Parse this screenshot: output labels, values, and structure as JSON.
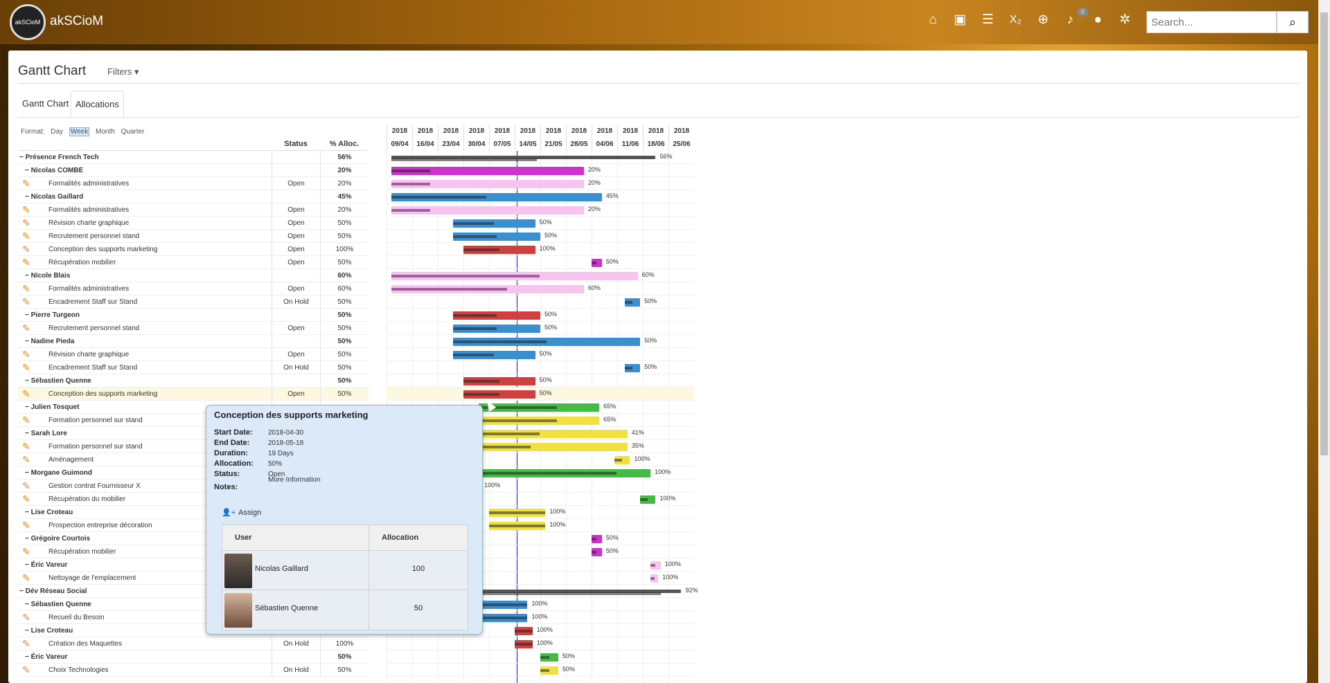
{
  "app": {
    "brand": "akSCioM",
    "logo_text": "akSCioM"
  },
  "nav": {
    "icons": [
      "home-icon",
      "briefcase-icon",
      "tasks-icon",
      "subscript-icon",
      "plus-circle-icon",
      "bell-icon",
      "user-icon",
      "gear-icon"
    ],
    "notification_count": "0",
    "search_placeholder": "Search..."
  },
  "page": {
    "title": "Gantt Chart",
    "filters_label": "Filters ▾",
    "tabs": [
      "Gantt Chart",
      "Allocations"
    ],
    "active_tab": "Allocations"
  },
  "format": {
    "label": "Format:",
    "options": [
      "Day",
      "Week",
      "Month",
      "Quarter"
    ],
    "selected": "Week"
  },
  "columns": {
    "status": "Status",
    "alloc": "% Alloc."
  },
  "timeline": {
    "years": [
      "2018",
      "2018",
      "2018",
      "2018",
      "2018",
      "2018",
      "2018",
      "2018",
      "2018",
      "2018",
      "2018",
      "2018"
    ],
    "weeks": [
      "09/04",
      "16/04",
      "23/04",
      "30/04",
      "07/05",
      "14/05",
      "21/05",
      "28/05",
      "04/06",
      "11/06",
      "18/06",
      "25/06"
    ]
  },
  "rows": [
    {
      "level": 0,
      "name": "Présence French Tech",
      "status": "",
      "alloc": "56%",
      "bar": {
        "s": 0.2,
        "e": 10.5,
        "color": "#555",
        "prog": 0.55,
        "summary": true,
        "label": "56%"
      }
    },
    {
      "level": 1,
      "name": "Nicolas COMBE",
      "status": "",
      "alloc": "20%",
      "bar": {
        "s": 0.2,
        "e": 7.7,
        "color": "#cc33cc",
        "prog": 0.2,
        "label": "20%"
      }
    },
    {
      "level": 2,
      "name": "Formalités administratives",
      "status": "Open",
      "alloc": "20%",
      "bar": {
        "s": 0.2,
        "e": 7.7,
        "color": "#f6c4ef",
        "prog": 0.2,
        "label": "20%",
        "dark": "#a060a0"
      }
    },
    {
      "level": 1,
      "name": "Nicolas Gaillard",
      "status": "",
      "alloc": "45%",
      "bar": {
        "s": 0.2,
        "e": 8.4,
        "color": "#3a8fd0",
        "prog": 0.45,
        "label": "45%"
      }
    },
    {
      "level": 2,
      "name": "Formalités administratives",
      "status": "Open",
      "alloc": "20%",
      "bar": {
        "s": 0.2,
        "e": 7.7,
        "color": "#f6c4ef",
        "prog": 0.2,
        "label": "20%",
        "dark": "#a060a0"
      }
    },
    {
      "level": 2,
      "name": "Révision charte graphique",
      "status": "Open",
      "alloc": "50%",
      "bar": {
        "s": 2.6,
        "e": 5.8,
        "color": "#3a8fd0",
        "prog": 0.5,
        "label": "50%"
      }
    },
    {
      "level": 2,
      "name": "Recrutement personnel stand",
      "status": "Open",
      "alloc": "50%",
      "bar": {
        "s": 2.6,
        "e": 6.0,
        "color": "#3a8fd0",
        "prog": 0.5,
        "label": "50%"
      }
    },
    {
      "level": 2,
      "name": "Conception des supports marketing",
      "status": "Open",
      "alloc": "100%",
      "bar": {
        "s": 3.0,
        "e": 5.8,
        "color": "#d04040",
        "prog": 0.5,
        "label": "100%"
      }
    },
    {
      "level": 2,
      "name": "Récupération mobilier",
      "status": "Open",
      "alloc": "50%",
      "bar": {
        "s": 8.0,
        "e": 8.4,
        "color": "#cc33cc",
        "prog": 0.5,
        "label": "50%"
      }
    },
    {
      "level": 1,
      "name": "Nicole Blais",
      "status": "",
      "alloc": "60%",
      "bar": {
        "s": 0.2,
        "e": 9.8,
        "color": "#f6c4ef",
        "prog": 0.6,
        "label": "60%",
        "dark": "#a060a0"
      }
    },
    {
      "level": 2,
      "name": "Formalités administratives",
      "status": "Open",
      "alloc": "60%",
      "bar": {
        "s": 0.2,
        "e": 7.7,
        "color": "#f6c4ef",
        "prog": 0.6,
        "label": "60%",
        "dark": "#a060a0"
      }
    },
    {
      "level": 2,
      "name": "Encadrement Staff sur Stand",
      "status": "On Hold",
      "alloc": "50%",
      "bar": {
        "s": 9.3,
        "e": 9.9,
        "color": "#3a8fd0",
        "prog": 0.5,
        "label": "50%"
      }
    },
    {
      "level": 1,
      "name": "Pierre Turgeon",
      "status": "",
      "alloc": "50%",
      "bar": {
        "s": 2.6,
        "e": 6.0,
        "color": "#d04040",
        "prog": 0.5,
        "label": "50%"
      }
    },
    {
      "level": 2,
      "name": "Recrutement personnel stand",
      "status": "Open",
      "alloc": "50%",
      "bar": {
        "s": 2.6,
        "e": 6.0,
        "color": "#3a8fd0",
        "prog": 0.5,
        "label": "50%"
      }
    },
    {
      "level": 1,
      "name": "Nadine Pieda",
      "status": "",
      "alloc": "50%",
      "bar": {
        "s": 2.6,
        "e": 9.9,
        "color": "#3a8fd0",
        "prog": 0.5,
        "label": "50%"
      }
    },
    {
      "level": 2,
      "name": "Révision charte graphique",
      "status": "Open",
      "alloc": "50%",
      "bar": {
        "s": 2.6,
        "e": 5.8,
        "color": "#3a8fd0",
        "prog": 0.5,
        "label": "50%"
      }
    },
    {
      "level": 2,
      "name": "Encadrement Staff sur Stand",
      "status": "On Hold",
      "alloc": "50%",
      "bar": {
        "s": 9.3,
        "e": 9.9,
        "color": "#3a8fd0",
        "prog": 0.5,
        "label": "50%"
      }
    },
    {
      "level": 1,
      "name": "Sébastien Quenne",
      "status": "",
      "alloc": "50%",
      "bar": {
        "s": 3.0,
        "e": 5.8,
        "color": "#d04040",
        "prog": 0.5,
        "label": "50%"
      }
    },
    {
      "level": 2,
      "name": "Conception des supports marketing",
      "status": "Open",
      "alloc": "50%",
      "bar": {
        "s": 3.0,
        "e": 5.8,
        "color": "#d04040",
        "prog": 0.5,
        "label": "50%"
      },
      "hi": true
    },
    {
      "level": 1,
      "name": "Julien Tosquet",
      "status": "",
      "alloc": "",
      "bar": {
        "s": 3.6,
        "e": 8.3,
        "color": "#44bb44",
        "prog": 0.65,
        "label": "65%"
      }
    },
    {
      "level": 2,
      "name": "Formation personnel sur stand",
      "status": "",
      "alloc": "",
      "bar": {
        "s": 3.6,
        "e": 8.3,
        "color": "#f0e040",
        "prog": 0.65,
        "label": "65%"
      }
    },
    {
      "level": 1,
      "name": "Sarah Lore",
      "status": "",
      "alloc": "",
      "bar": {
        "s": 3.6,
        "e": 9.4,
        "color": "#f0e040",
        "prog": 0.41,
        "label": "41%"
      }
    },
    {
      "level": 2,
      "name": "Formation personnel sur stand",
      "status": "",
      "alloc": "",
      "bar": {
        "s": 3.6,
        "e": 9.4,
        "color": "#f0e040",
        "prog": 0.35,
        "label": "35%"
      }
    },
    {
      "level": 2,
      "name": "Aménagement",
      "status": "",
      "alloc": "",
      "bar": {
        "s": 8.9,
        "e": 9.5,
        "color": "#f0e040",
        "prog": 0.5,
        "label": "100%"
      }
    },
    {
      "level": 1,
      "name": "Morgane Guimond",
      "status": "",
      "alloc": "",
      "bar": {
        "s": 3.6,
        "e": 10.3,
        "color": "#44bb44",
        "prog": 0.8,
        "label": "100%"
      }
    },
    {
      "level": 2,
      "name": "Gestion contrat Fournisseur X",
      "status": "",
      "alloc": "",
      "bar": {
        "s": 3.6,
        "e": 3.6,
        "color": "#44bb44",
        "prog": 0,
        "label": "100%"
      }
    },
    {
      "level": 2,
      "name": "Récupération du mobilier",
      "status": "",
      "alloc": "",
      "bar": {
        "s": 9.9,
        "e": 10.5,
        "color": "#44bb44",
        "prog": 0.5,
        "label": "100%"
      }
    },
    {
      "level": 1,
      "name": "Lise Croteau",
      "status": "",
      "alloc": "",
      "bar": {
        "s": 4.0,
        "e": 6.2,
        "color": "#f0e040",
        "prog": 1,
        "label": "100%"
      }
    },
    {
      "level": 2,
      "name": "Prospection entreprise décoration",
      "status": "",
      "alloc": "",
      "bar": {
        "s": 4.0,
        "e": 6.2,
        "color": "#f0e040",
        "prog": 1,
        "label": "100%"
      }
    },
    {
      "level": 1,
      "name": "Grégoire Courtois",
      "status": "",
      "alloc": "",
      "bar": {
        "s": 8.0,
        "e": 8.4,
        "color": "#cc33cc",
        "prog": 0.5,
        "label": "50%"
      }
    },
    {
      "level": 2,
      "name": "Récupération mobilier",
      "status": "",
      "alloc": "",
      "bar": {
        "s": 8.0,
        "e": 8.4,
        "color": "#cc33cc",
        "prog": 0.5,
        "label": "50%"
      }
    },
    {
      "level": 1,
      "name": "Éric Vareur",
      "status": "",
      "alloc": "",
      "bar": {
        "s": 10.3,
        "e": 10.7,
        "color": "#f6c4ef",
        "prog": 0.5,
        "label": "100%",
        "dark": "#a060a0"
      }
    },
    {
      "level": 2,
      "name": "Nettoyage de l'emplacement",
      "status": "",
      "alloc": "",
      "bar": {
        "s": 10.3,
        "e": 10.6,
        "color": "#f6c4ef",
        "prog": 0.5,
        "label": "100%",
        "dark": "#a060a0"
      }
    },
    {
      "level": 0,
      "name": "Dév Réseau Social",
      "status": "",
      "alloc": "",
      "bar": {
        "s": 3.6,
        "e": 11.5,
        "color": "#555",
        "prog": 0.9,
        "summary": true,
        "label": "92%"
      }
    },
    {
      "level": 1,
      "name": "Sébastien Quenne",
      "status": "",
      "alloc": "",
      "bar": {
        "s": 3.6,
        "e": 5.5,
        "color": "#3a8fd0",
        "prog": 1,
        "label": "100%"
      }
    },
    {
      "level": 2,
      "name": "Recueil du Besoin",
      "status": "",
      "alloc": "",
      "bar": {
        "s": 3.6,
        "e": 5.5,
        "color": "#3a8fd0",
        "prog": 1,
        "label": "100%"
      }
    },
    {
      "level": 1,
      "name": "Lise Croteau",
      "status": "",
      "alloc": "",
      "bar": {
        "s": 5.0,
        "e": 5.7,
        "color": "#d04040",
        "prog": 1,
        "label": "100%"
      }
    },
    {
      "level": 2,
      "name": "Création des Maquettes",
      "status": "On Hold",
      "alloc": "100%",
      "bar": {
        "s": 5.0,
        "e": 5.7,
        "color": "#d04040",
        "prog": 1,
        "label": "100%"
      }
    },
    {
      "level": 1,
      "name": "Éric Vareur",
      "status": "",
      "alloc": "50%",
      "bar": {
        "s": 6.0,
        "e": 6.7,
        "color": "#44bb44",
        "prog": 0.5,
        "label": "50%"
      }
    },
    {
      "level": 2,
      "name": "Choix Technologies",
      "status": "On Hold",
      "alloc": "50%",
      "bar": {
        "s": 6.0,
        "e": 6.7,
        "color": "#f0e040",
        "prog": 0.5,
        "label": "50%"
      }
    }
  ],
  "tooltip": {
    "title": "Conception des supports marketing",
    "fields": [
      {
        "label": "Start Date:",
        "value": "2018-04-30"
      },
      {
        "label": "End Date:",
        "value": "2018-05-18"
      },
      {
        "label": "Duration:",
        "value": "19 Days"
      },
      {
        "label": "Allocation:",
        "value": "50%"
      },
      {
        "label": "Status:",
        "value": "Open"
      },
      {
        "label": "Notes:",
        "value": "More Information"
      }
    ],
    "assign_label": "Assign",
    "table_headers": {
      "user": "User",
      "allocation": "Allocation"
    },
    "users": [
      {
        "name": "Nicolas Gaillard",
        "allocation": "100"
      },
      {
        "name": "Sébastien Quenne",
        "allocation": "50"
      }
    ]
  }
}
